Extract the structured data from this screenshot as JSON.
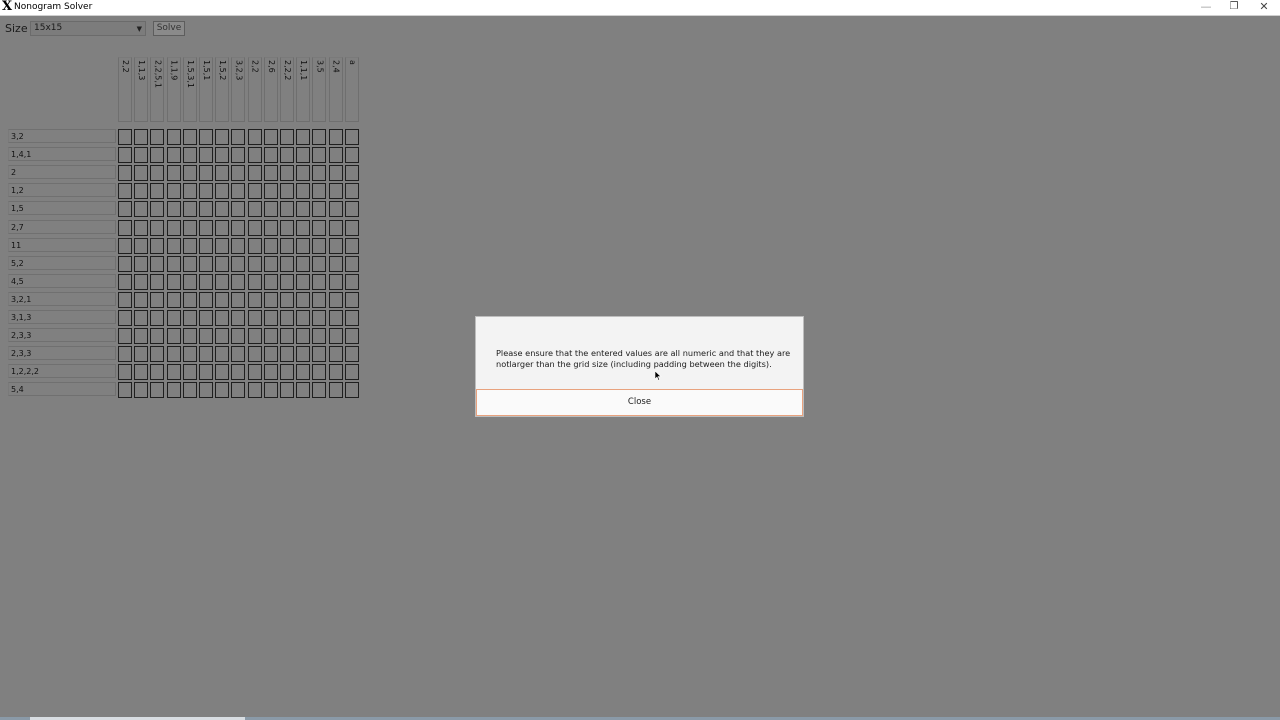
{
  "window": {
    "title": "Nonogram Solver",
    "icon": "x-app-icon",
    "minimize": "—",
    "maximize": "❐",
    "close": "✕"
  },
  "toolbar": {
    "size_label": "Size",
    "size_value": "15x15",
    "solve_label": "Solve"
  },
  "column_clues": [
    "2,2",
    "1,1,3",
    "2,2,5,1",
    "1,1,9",
    "1,5,3,1",
    "1,5,1",
    "1,5,2",
    "3,2,3",
    "2,2",
    "2,6",
    "2,2,2",
    "1,1,1",
    "3,5",
    "2,4",
    "a"
  ],
  "row_clues": [
    "3,2",
    "1,4,1",
    "2",
    "1,2",
    "1,5",
    "2,7",
    "11",
    "5,2",
    "4,5",
    "3,2,1",
    "3,1,3",
    "2,3,3",
    "2,3,3",
    "1,2,2,2",
    "5,4"
  ],
  "grid": {
    "rows": 15,
    "cols": 15
  },
  "dialog": {
    "message": "Please ensure that the entered values are all numeric and that they are notlarger than the grid size (including padding between the digits).",
    "close_label": "Close"
  },
  "colors": {
    "background": "#808080",
    "dialog_bg": "#f3f3f3",
    "close_border": "#e8a27e"
  }
}
